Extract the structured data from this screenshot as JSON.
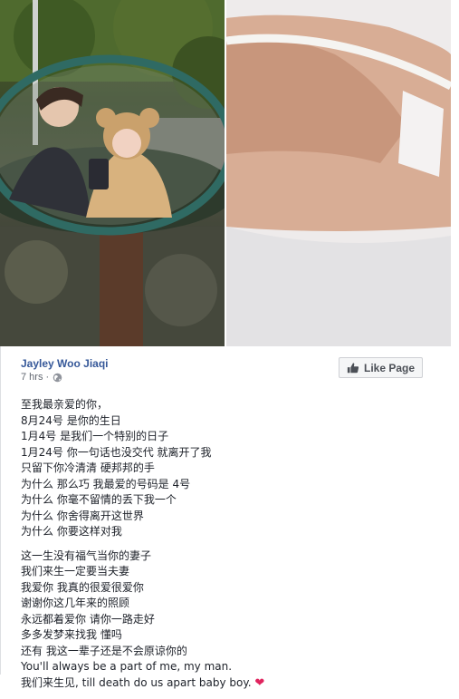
{
  "post": {
    "author": "Jayley Woo Jiaqi",
    "timestamp": "7 hrs ·",
    "like_page_label": "Like Page",
    "paragraphs": [
      [
        "至我最亲爱的你，",
        "8月24号 是你的生日",
        "1月4号 是我们一个特别的日子",
        "1月24号 你一句话也没交代 就离开了我",
        "只留下你冷清清 硬邦邦的手",
        "为什么 那么巧 我最爱的号码是 4号",
        "为什么 你毫不留情的丢下我一个",
        "为什么 你舍得离开这世界",
        "为什么 你要这样对我"
      ],
      [
        "这一生没有福气当你的妻子",
        "我们来生一定要当夫妻",
        "我爱你 我真的很爱很爱你",
        "谢谢你这几年来的照顾",
        "永远都着爱你 请你一路走好",
        "多多发梦来找我 懂吗",
        "还有 我这一辈子还是不会原谅你的",
        "You'll always be a part of me, my man.",
        "我们来生见, till death do us apart baby boy."
      ]
    ],
    "heart_emoji": "❤"
  }
}
